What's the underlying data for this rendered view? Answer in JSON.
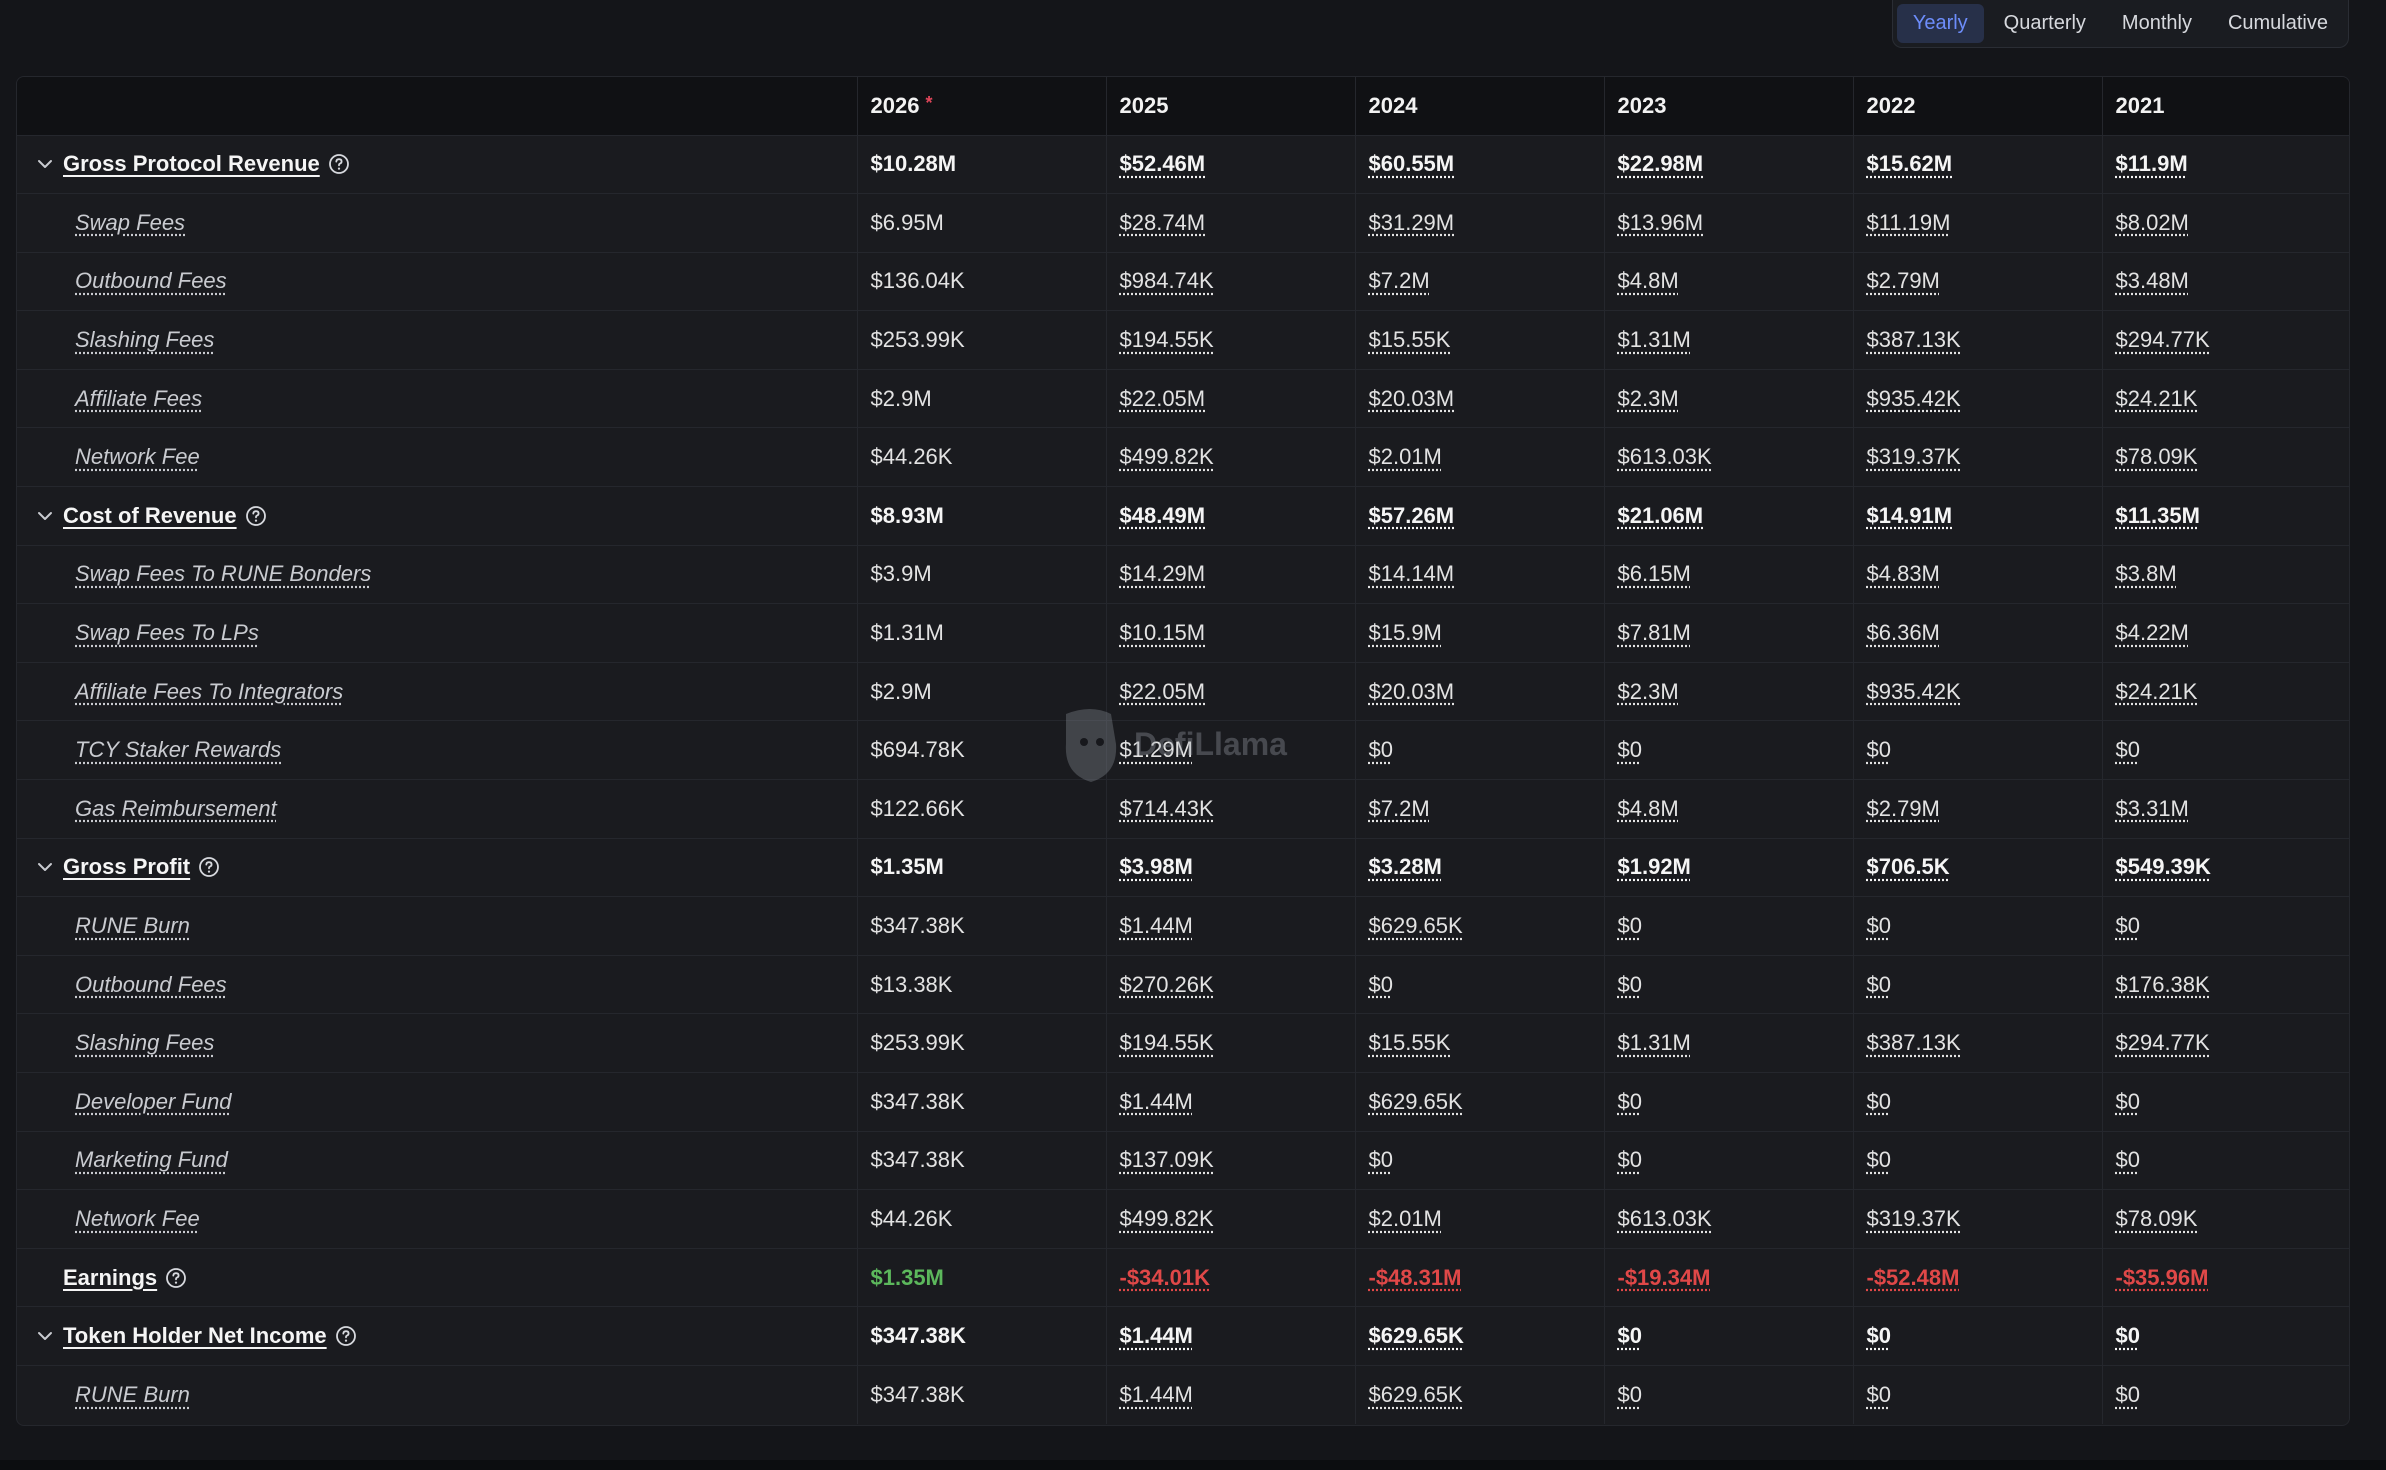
{
  "period_options": [
    {
      "label": "Yearly",
      "active": true
    },
    {
      "label": "Quarterly",
      "active": false
    },
    {
      "label": "Monthly",
      "active": false
    },
    {
      "label": "Cumulative",
      "active": false
    }
  ],
  "columns": [
    "2026",
    "2025",
    "2024",
    "2023",
    "2022",
    "2021"
  ],
  "estimate_marker": "*",
  "watermark": "DefiLlama",
  "rows": [
    {
      "label": "Gross Protocol Revenue",
      "type": "group",
      "values": [
        "$10.28M",
        "$52.46M",
        "$60.55M",
        "$22.98M",
        "$15.62M",
        "$11.9M"
      ]
    },
    {
      "label": "Swap Fees",
      "type": "child",
      "values": [
        "$6.95M",
        "$28.74M",
        "$31.29M",
        "$13.96M",
        "$11.19M",
        "$8.02M"
      ]
    },
    {
      "label": "Outbound Fees",
      "type": "child",
      "values": [
        "$136.04K",
        "$984.74K",
        "$7.2M",
        "$4.8M",
        "$2.79M",
        "$3.48M"
      ]
    },
    {
      "label": "Slashing Fees",
      "type": "child",
      "values": [
        "$253.99K",
        "$194.55K",
        "$15.55K",
        "$1.31M",
        "$387.13K",
        "$294.77K"
      ]
    },
    {
      "label": "Affiliate Fees",
      "type": "child",
      "values": [
        "$2.9M",
        "$22.05M",
        "$20.03M",
        "$2.3M",
        "$935.42K",
        "$24.21K"
      ]
    },
    {
      "label": "Network Fee",
      "type": "child",
      "values": [
        "$44.26K",
        "$499.82K",
        "$2.01M",
        "$613.03K",
        "$319.37K",
        "$78.09K"
      ]
    },
    {
      "label": "Cost of Revenue",
      "type": "group",
      "values": [
        "$8.93M",
        "$48.49M",
        "$57.26M",
        "$21.06M",
        "$14.91M",
        "$11.35M"
      ]
    },
    {
      "label": "Swap Fees To RUNE Bonders",
      "type": "child",
      "values": [
        "$3.9M",
        "$14.29M",
        "$14.14M",
        "$6.15M",
        "$4.83M",
        "$3.8M"
      ]
    },
    {
      "label": "Swap Fees To LPs",
      "type": "child",
      "values": [
        "$1.31M",
        "$10.15M",
        "$15.9M",
        "$7.81M",
        "$6.36M",
        "$4.22M"
      ]
    },
    {
      "label": "Affiliate Fees To Integrators",
      "type": "child",
      "values": [
        "$2.9M",
        "$22.05M",
        "$20.03M",
        "$2.3M",
        "$935.42K",
        "$24.21K"
      ]
    },
    {
      "label": "TCY Staker Rewards",
      "type": "child",
      "values": [
        "$694.78K",
        "$1.29M",
        "$0",
        "$0",
        "$0",
        "$0"
      ]
    },
    {
      "label": "Gas Reimbursement",
      "type": "child",
      "values": [
        "$122.66K",
        "$714.43K",
        "$7.2M",
        "$4.8M",
        "$2.79M",
        "$3.31M"
      ]
    },
    {
      "label": "Gross Profit",
      "type": "group",
      "values": [
        "$1.35M",
        "$3.98M",
        "$3.28M",
        "$1.92M",
        "$706.5K",
        "$549.39K"
      ]
    },
    {
      "label": "RUNE Burn",
      "type": "child",
      "values": [
        "$347.38K",
        "$1.44M",
        "$629.65K",
        "$0",
        "$0",
        "$0"
      ]
    },
    {
      "label": "Outbound Fees",
      "type": "child",
      "values": [
        "$13.38K",
        "$270.26K",
        "$0",
        "$0",
        "$0",
        "$176.38K"
      ]
    },
    {
      "label": "Slashing Fees",
      "type": "child",
      "values": [
        "$253.99K",
        "$194.55K",
        "$15.55K",
        "$1.31M",
        "$387.13K",
        "$294.77K"
      ]
    },
    {
      "label": "Developer Fund",
      "type": "child",
      "values": [
        "$347.38K",
        "$1.44M",
        "$629.65K",
        "$0",
        "$0",
        "$0"
      ]
    },
    {
      "label": "Marketing Fund",
      "type": "child",
      "values": [
        "$347.38K",
        "$137.09K",
        "$0",
        "$0",
        "$0",
        "$0"
      ]
    },
    {
      "label": "Network Fee",
      "type": "child",
      "values": [
        "$44.26K",
        "$499.82K",
        "$2.01M",
        "$613.03K",
        "$319.37K",
        "$78.09K"
      ]
    },
    {
      "label": "Earnings",
      "type": "earnings",
      "values": [
        "$1.35M",
        "-$34.01K",
        "-$48.31M",
        "-$19.34M",
        "-$52.48M",
        "-$35.96M"
      ]
    },
    {
      "label": "Token Holder Net Income",
      "type": "group",
      "values": [
        "$347.38K",
        "$1.44M",
        "$629.65K",
        "$0",
        "$0",
        "$0"
      ]
    },
    {
      "label": "RUNE Burn",
      "type": "child",
      "values": [
        "$347.38K",
        "$1.44M",
        "$629.65K",
        "$0",
        "$0",
        "$0"
      ]
    }
  ],
  "colors": {
    "background": "#141519",
    "accent": "#6d8dfb",
    "positive": "#5cb85c",
    "negative": "#e04848"
  }
}
